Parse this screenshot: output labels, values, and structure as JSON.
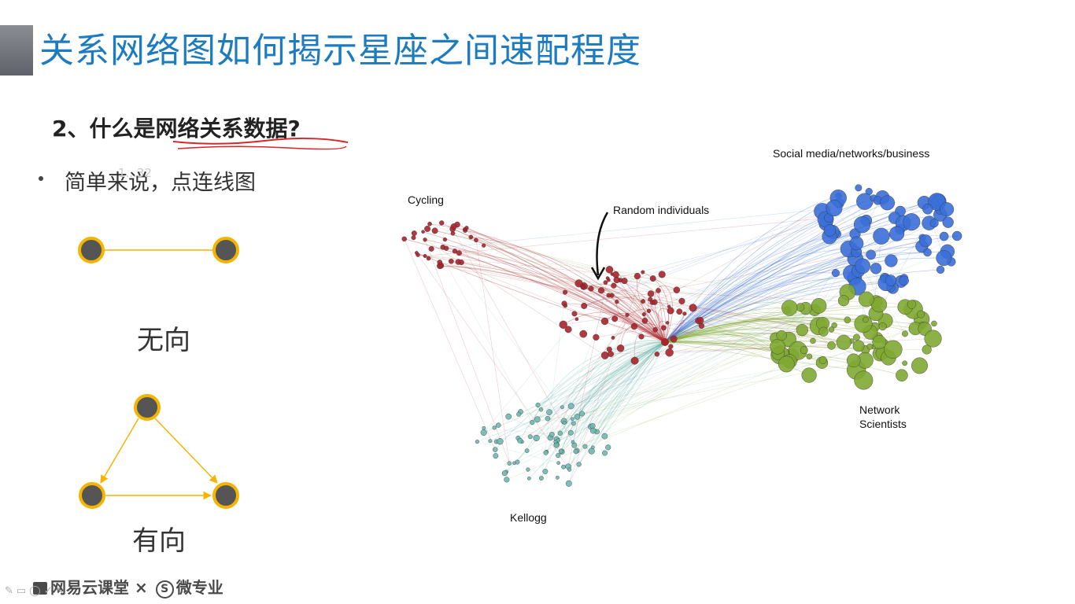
{
  "slide": {
    "title": "关系网络图如何揭示星座之间速配程度",
    "subtitle_prefix": "2、什么是",
    "subtitle_highlight": "网络关系数据",
    "subtitle_suffix": "?",
    "bullet": "简单来说，点连线图",
    "ghost_stamp": "1...32",
    "caption_undirected": "无向",
    "caption_directed": "有向"
  },
  "network": {
    "labels": {
      "social": "Social media/networks/business",
      "cycling": "Cycling",
      "random": "Random individuals",
      "network_scientists_1": "Network",
      "network_scientists_2": "Scientists",
      "kellogg": "Kellogg"
    },
    "cluster_colors": {
      "social": "#3b6fd8",
      "scientists": "#7fa832",
      "cycling": "#a8242a",
      "kellogg": "#6fb8b0"
    }
  },
  "footer": {
    "brand": "网易云课堂",
    "times": "×",
    "s_icon": "S",
    "partner": "微专业"
  },
  "colors": {
    "title": "#1d7bbf",
    "node_ring": "#f5b400",
    "node_fill": "#555555"
  }
}
